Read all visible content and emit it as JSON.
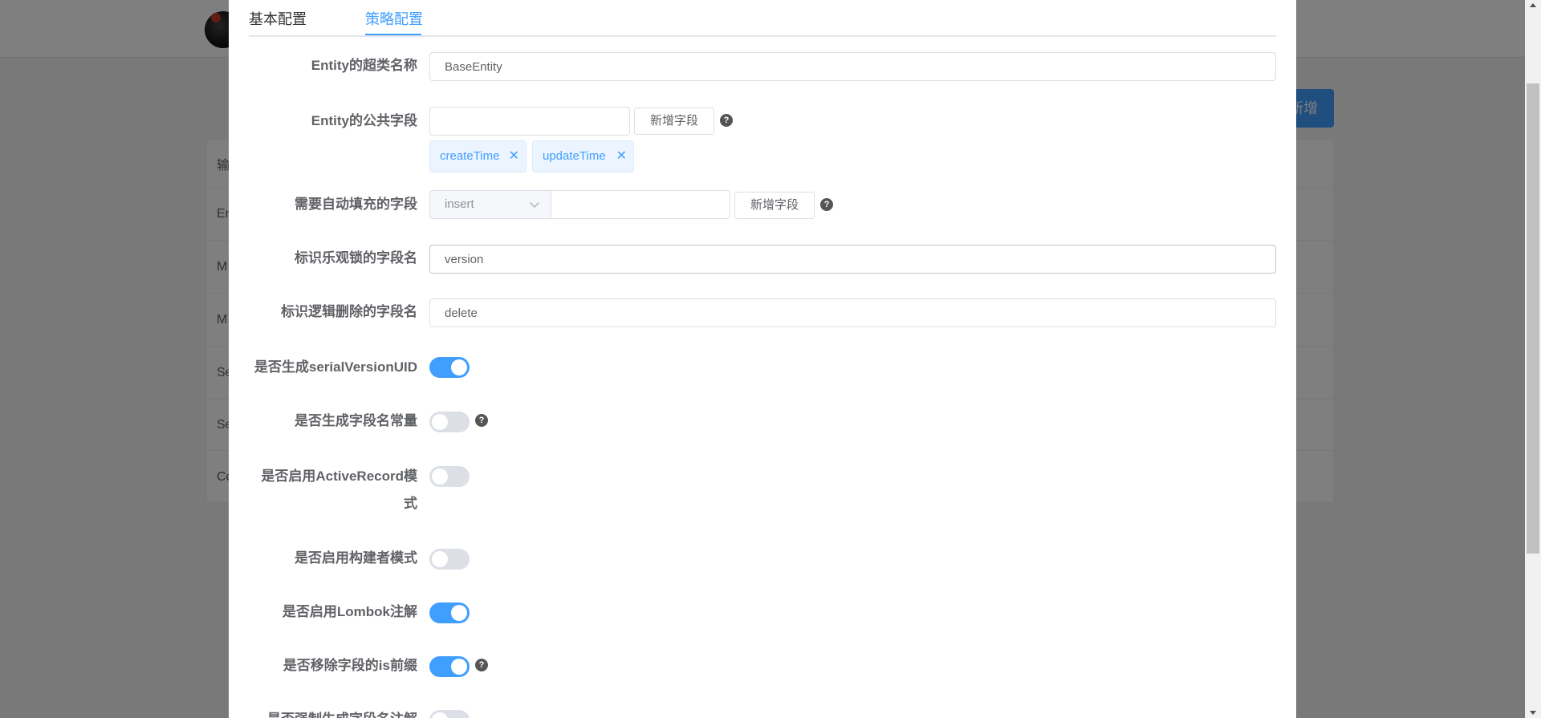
{
  "background": {
    "add_button_label": "新增",
    "table_rows": [
      "输",
      "En",
      "M",
      "M",
      "Se",
      "Se",
      "Co"
    ]
  },
  "tabs": [
    {
      "label": "基本配置",
      "active": false
    },
    {
      "label": "策略配置",
      "active": true
    }
  ],
  "form": {
    "super_entity": {
      "label": "Entity的超类名称",
      "value": "BaseEntity"
    },
    "common_fields": {
      "label": "Entity的公共字段",
      "input_value": "",
      "add_button": "新增字段",
      "tags": [
        "createTime",
        "updateTime"
      ]
    },
    "auto_fill": {
      "label": "需要自动填充的字段",
      "select_value": "insert",
      "input_value": "",
      "add_button": "新增字段"
    },
    "version_field": {
      "label": "标识乐观锁的字段名",
      "value": "version"
    },
    "logic_delete_field": {
      "label": "标识逻辑删除的字段名",
      "value": "delete"
    },
    "switches": [
      {
        "label": "是否生成serialVersionUID",
        "on": true,
        "help": false
      },
      {
        "label": "是否生成字段名常量",
        "on": false,
        "help": true
      },
      {
        "label": "是否启用ActiveRecord模式",
        "on": false,
        "help": false
      },
      {
        "label": "是否启用构建者模式",
        "on": false,
        "help": false
      },
      {
        "label": "是否启用Lombok注解",
        "on": true,
        "help": false
      },
      {
        "label": "是否移除字段的is前缀",
        "on": true,
        "help": true
      },
      {
        "label": "是否强制生成字段名注解",
        "on": false,
        "help": false
      }
    ]
  },
  "icons": {
    "help": "question-circle-icon",
    "tag_close": "close-icon",
    "select_arrow": "chevron-down-icon"
  },
  "colors": {
    "primary": "#409eff",
    "switch_off": "#dcdfe6",
    "label": "#606266"
  }
}
